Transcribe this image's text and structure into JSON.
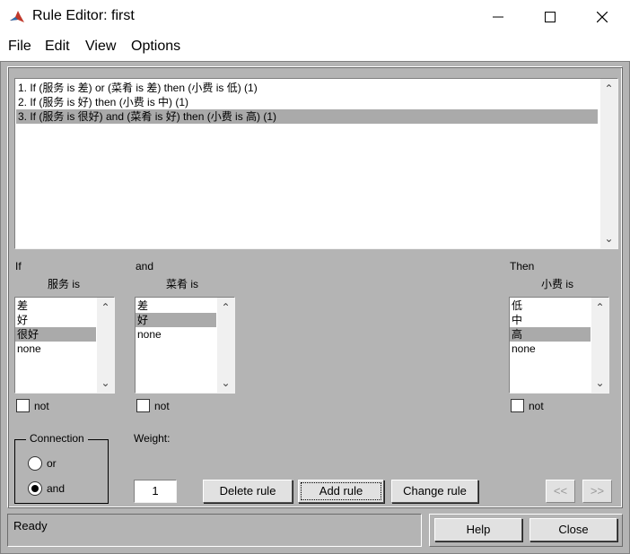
{
  "window": {
    "title": "Rule Editor: first",
    "minimize_icon": "minimize-icon",
    "maximize_icon": "maximize-icon",
    "close_icon": "close-icon",
    "app_icon": "matlab-icon"
  },
  "menu": [
    "File",
    "Edit",
    "View",
    "Options"
  ],
  "rules": [
    "1. If (服务 is 差) or (菜肴 is 差) then (小费 is 低) (1)",
    "2. If (服务 is 好) then (小费 is 中) (1)",
    "3. If (服务 is 很好) and (菜肴 is 好) then (小费 is 高) (1)"
  ],
  "rules_selected_index": 2,
  "input1": {
    "prefix": "If",
    "label": "服务 is",
    "options": [
      "差",
      "好",
      "很好",
      "none"
    ],
    "selected_index": 2,
    "not_label": "not"
  },
  "input2": {
    "prefix": "and",
    "label": "菜肴 is",
    "options": [
      "差",
      "好",
      "none"
    ],
    "selected_index": 1,
    "not_label": "not"
  },
  "output": {
    "prefix": "Then",
    "label": "小费 is",
    "options": [
      "低",
      "中",
      "高",
      "none"
    ],
    "selected_index": 2,
    "not_label": "not"
  },
  "connection": {
    "label": "Connection",
    "options": [
      "or",
      "and"
    ],
    "selected": "and"
  },
  "weight": {
    "label": "Weight:",
    "value": "1"
  },
  "buttons": {
    "delete": "Delete rule",
    "add": "Add rule",
    "change": "Change rule",
    "prev": "<<",
    "next": ">>",
    "help": "Help",
    "close": "Close"
  },
  "status": "Ready"
}
